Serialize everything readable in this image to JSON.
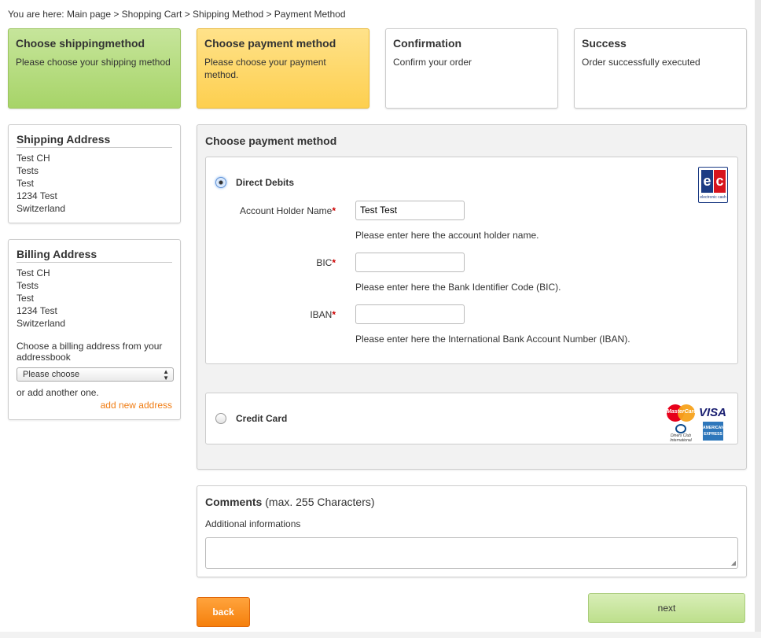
{
  "breadcrumb": "You are here: Main page > Shopping Cart > Shipping Method > Payment Method",
  "steps": [
    {
      "title": "Choose shippingmethod",
      "desc": "Please choose your shipping method",
      "state": "done"
    },
    {
      "title": "Choose payment method",
      "desc": "Please choose your payment method.",
      "state": "active"
    },
    {
      "title": "Confirmation",
      "desc": "Confirm your order",
      "state": "pending"
    },
    {
      "title": "Success",
      "desc": "Order successfully executed",
      "state": "pending"
    }
  ],
  "shipping_address": {
    "title": "Shipping Address",
    "lines": [
      "Test CH",
      "Tests",
      "Test",
      "1234 Test",
      "Switzerland"
    ]
  },
  "billing_address": {
    "title": "Billing Address",
    "lines": [
      "Test CH",
      "Tests",
      "Test",
      "1234 Test",
      "Switzerland"
    ],
    "choose_note": "Choose a billing address from your addressbook",
    "select_value": "Please choose",
    "or_text": "or add another one.",
    "add_link": "add new address"
  },
  "payment": {
    "title": "Choose payment method",
    "direct_debit": {
      "label": "Direct Debits",
      "selected": true,
      "logo_caption": "electronic cash",
      "fields": [
        {
          "label": "Account Holder Name",
          "required_mark": "*",
          "value": "Test Test",
          "hint": "Please enter here the account holder name."
        },
        {
          "label": "BIC",
          "required_mark": "*",
          "value": "",
          "hint": "Please enter here the Bank Identifier Code (BIC)."
        },
        {
          "label": "IBAN",
          "required_mark": "*",
          "value": "",
          "hint": "Please enter here the International Bank Account Number (IBAN)."
        }
      ]
    },
    "credit_card": {
      "label": "Credit Card",
      "selected": false,
      "logos": {
        "mastercard": "MasterCard",
        "visa": "VISA",
        "diners": "Diners Club International",
        "amex": "AMERICAN EXPRESS"
      }
    }
  },
  "comments": {
    "title": "Comments",
    "title_suffix": "(max. 255 Characters)",
    "subtitle": "Additional informations",
    "value": ""
  },
  "buttons": {
    "back": "back",
    "next": "next"
  },
  "colors": {
    "accent_orange": "#f5800c",
    "step_done_green": "#a7d468",
    "step_active_yellow": "#fdcf4f",
    "next_green": "#bddf8c"
  }
}
